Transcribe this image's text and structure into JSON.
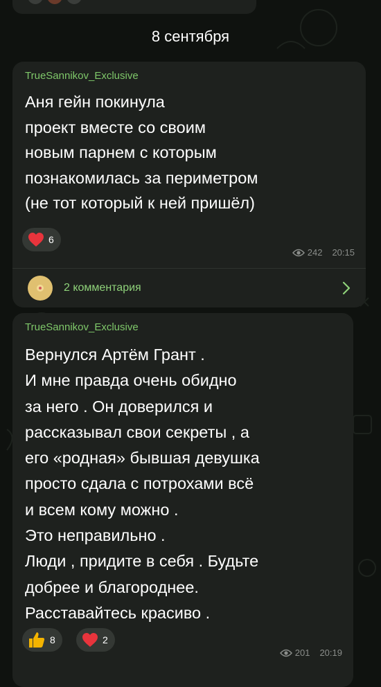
{
  "date_separator": "8 сентября",
  "posts": [
    {
      "author": "TrueSannikov_Exclusive",
      "text": "Аня гейн покинула\nпроект вместе со своим\nновым парнем с которым\nпознакомилась за периметром\n(не тот который к ней пришёл)",
      "reactions": [
        {
          "icon": "heart-icon",
          "count": "6"
        }
      ],
      "views": "242",
      "time": "20:15",
      "comments_label": "2 комментария"
    },
    {
      "author": "TrueSannikov_Exclusive",
      "text": "Вернулся Артём Грант .\nИ мне правда очень обидно\nза него . Он доверился и\nрассказывал свои секреты , а\nего «родная» бывшая девушка\nпросто сдала с потрохами всё\nи всем кому можно .\nЭто неправильно .\nЛюди , придите в себя . Будьте\nдобрее и благороднее.\nРасставайтесь красиво .",
      "reactions": [
        {
          "icon": "thumbs-up-icon",
          "count": "8"
        },
        {
          "icon": "heart-icon",
          "count": "2"
        }
      ],
      "views": "201",
      "time": "20:19"
    }
  ],
  "colors": {
    "background": "#0f120f",
    "bubble": "#1e211e",
    "author": "#7fc86a",
    "link": "#8fd27a",
    "heart": "#e8343c",
    "thumb": "#f4b400"
  }
}
